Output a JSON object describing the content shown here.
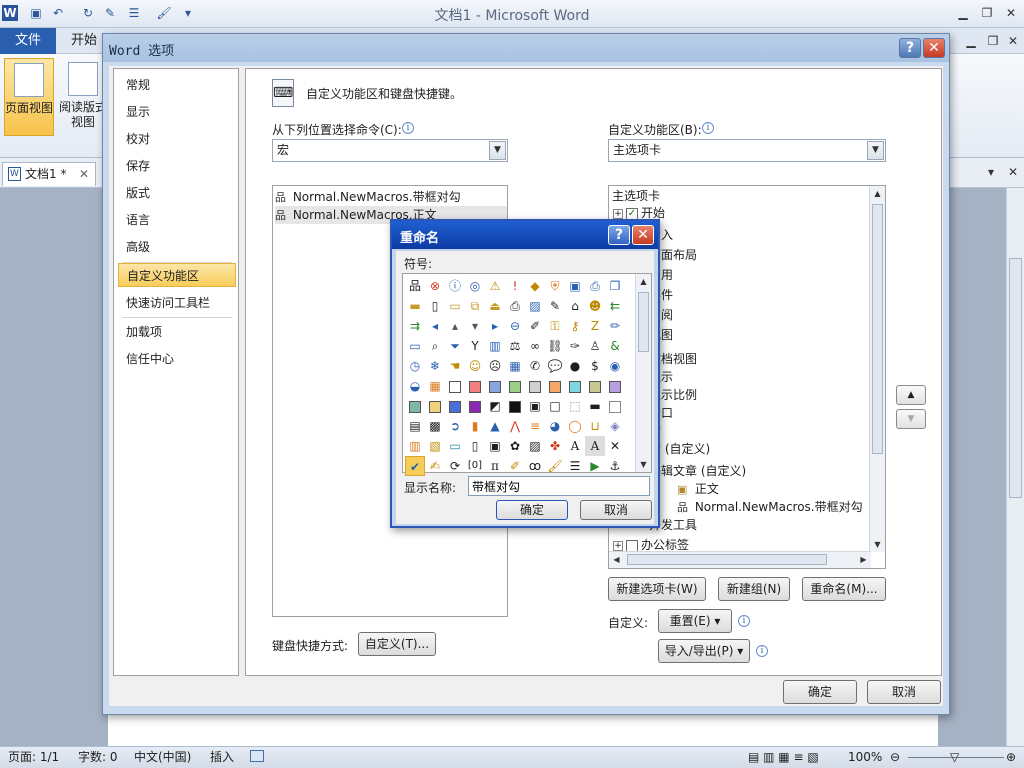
{
  "word": {
    "title": "文档1 - Microsoft Word",
    "tab_file": "文件",
    "tab_home": "开始",
    "rb_print_label": "页面视图",
    "rb_read_label": "阅读版式视图",
    "doc_tab": "文档1 *"
  },
  "status": {
    "page": "页面: 1/1",
    "words": "字数: 0",
    "lang": "中文(中国)",
    "mode": "插入",
    "zoom": "100%"
  },
  "options": {
    "title": "Word 选项",
    "nav": [
      "常规",
      "显示",
      "校对",
      "保存",
      "版式",
      "语言",
      "高级",
      "自定义功能区",
      "快速访问工具栏",
      "加载项",
      "信任中心"
    ],
    "active_nav": 7,
    "header": "自定义功能区和键盘快捷键。",
    "choose_label": "从下列位置选择命令(C):",
    "choose_value": "宏",
    "customize_label": "自定义功能区(B):",
    "customize_value": "主选项卡",
    "commands": [
      "Normal.NewMacros.带框对勾",
      "Normal.NewMacros.正文"
    ],
    "tree_header": "主选项卡",
    "tree": [
      "开始",
      "插入",
      "页面布局",
      "引用",
      "邮件",
      "审阅",
      "视图",
      "文档视图",
      "显示",
      "显示比例",
      "窗口",
      "宏",
      "宏 (自定义)",
      "编辑文章 (自定义)",
      "正文",
      "Normal.NewMacros.带框对勾",
      "加载项",
      "开发工具",
      "办公标签"
    ],
    "btn_new_tab": "新建选项卡(W)",
    "btn_new_group": "新建组(N)",
    "btn_rename": "重命名(M)...",
    "customize_text": "自定义:",
    "btn_reset": "重置(E) ▾",
    "btn_import": "导入/导出(P) ▾",
    "kb_label": "键盘快捷方式:",
    "btn_kb": "自定义(T)...",
    "btn_ok": "确定",
    "btn_cancel": "取消"
  },
  "rename": {
    "title": "重命名",
    "symbol_label": "符号:",
    "display_label": "显示名称:",
    "display_value": "带框对勾",
    "btn_ok": "确定",
    "btn_cancel": "取消"
  }
}
